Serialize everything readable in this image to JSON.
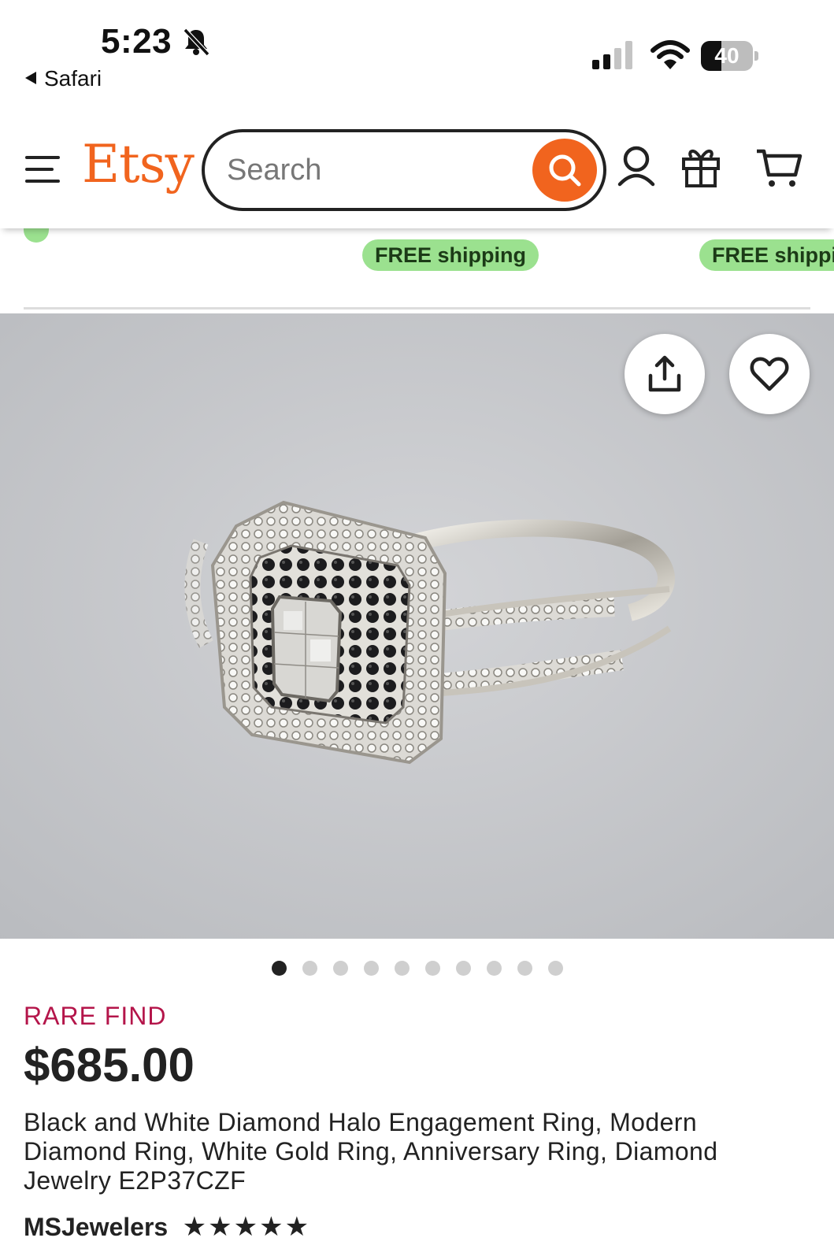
{
  "status_bar": {
    "time": "5:23",
    "back_app": "Safari",
    "battery": "40",
    "battery_level": 0.4,
    "signal_bars_active": 2,
    "signal_bars_total": 4
  },
  "header": {
    "logo": "Etsy",
    "search_placeholder": "Search",
    "brand_color": "#f1641e"
  },
  "carousel_strip": {
    "pills": [
      "FREE shipping",
      "FREE shipping"
    ],
    "pill_color": "#9be18f"
  },
  "product": {
    "image_dots_total": 10,
    "image_dot_active": 1,
    "badge": "RARE FIND",
    "price": "$685.00",
    "title": "Black and White Diamond Halo Engagement Ring, Modern Diamond Ring, White Gold Ring, Anniversary Ring, Diamond Jewelry E2P37CZF",
    "seller": "MSJewelers",
    "rating": "★★★★★",
    "rating_value": 5
  },
  "icons": {
    "menu": "hamburger-icon",
    "search": "search-icon",
    "account": "account-icon",
    "gift": "gift-icon",
    "cart": "cart-icon",
    "share": "share-icon",
    "favorite": "heart-icon",
    "notifications": "bell-slash-icon"
  }
}
